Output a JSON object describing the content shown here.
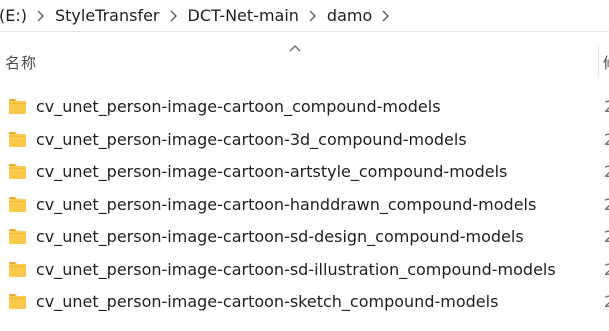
{
  "breadcrumb": {
    "items": [
      {
        "label": "(E:)"
      },
      {
        "label": "StyleTransfer"
      },
      {
        "label": "DCT-Net-main"
      },
      {
        "label": "damo"
      }
    ]
  },
  "header": {
    "name_column": "名称",
    "next_column": "修"
  },
  "folders": [
    {
      "name": "cv_unet_person-image-cartoon_compound-models",
      "date": "2"
    },
    {
      "name": "cv_unet_person-image-cartoon-3d_compound-models",
      "date": "2"
    },
    {
      "name": "cv_unet_person-image-cartoon-artstyle_compound-models",
      "date": "2"
    },
    {
      "name": "cv_unet_person-image-cartoon-handdrawn_compound-models",
      "date": "2"
    },
    {
      "name": "cv_unet_person-image-cartoon-sd-design_compound-models",
      "date": "2"
    },
    {
      "name": "cv_unet_person-image-cartoon-sd-illustration_compound-models",
      "date": "2"
    },
    {
      "name": "cv_unet_person-image-cartoon-sketch_compound-models",
      "date": "2"
    }
  ],
  "icons": {
    "folder": "folder-icon",
    "separator": "chevron-right-icon",
    "sort": "sort-ascending-icon"
  },
  "colors": {
    "folder_body": "#f8c94a",
    "folder_tab": "#e9ab2b"
  }
}
